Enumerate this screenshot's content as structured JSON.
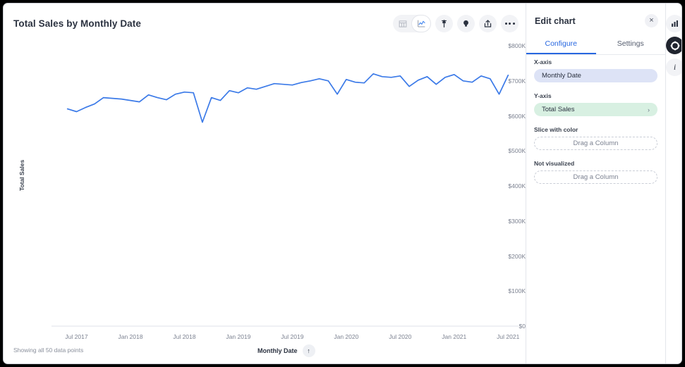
{
  "chart_card": {
    "title": "Total Sales by Monthly Date",
    "footer_note": "Showing all 50 data points",
    "sort_label": "Monthly Date",
    "sort_arrow": "↑",
    "toolbar": [
      {
        "name": "table-view-icon",
        "label": "Table view"
      },
      {
        "name": "line-chart-view-icon",
        "label": "Line chart view"
      },
      {
        "name": "pin-icon",
        "label": "Pin"
      },
      {
        "name": "insights-bulb-icon",
        "label": "Insights"
      },
      {
        "name": "share-icon",
        "label": "Share"
      },
      {
        "name": "more-options-icon",
        "label": "More options"
      }
    ]
  },
  "chart_data": {
    "type": "line",
    "title": "Total Sales by Monthly Date",
    "xlabel": "Monthly Date",
    "ylabel": "Total Sales",
    "grid": false,
    "legend": false,
    "line_color": "#3b7ae8",
    "ylim": [
      0,
      800000
    ],
    "ytick_labels": [
      "$800K",
      "$700K",
      "$600K",
      "$500K",
      "$400K",
      "$300K",
      "$200K",
      "$100K",
      "$0"
    ],
    "ytick_values": [
      800000,
      700000,
      600000,
      500000,
      400000,
      300000,
      200000,
      100000,
      0
    ],
    "xtick_labels": [
      "Jul 2017",
      "Jan 2018",
      "Jul 2018",
      "Jan 2019",
      "Jul 2019",
      "Jan 2020",
      "Jul 2020",
      "Jan 2021",
      "Jul 2021"
    ],
    "xtick_indices": [
      2,
      8,
      14,
      20,
      26,
      32,
      38,
      44,
      50
    ],
    "point_count": 50,
    "x": [
      "May 2017",
      "Jun 2017",
      "Jul 2017",
      "Aug 2017",
      "Sep 2017",
      "Oct 2017",
      "Nov 2017",
      "Dec 2017",
      "Jan 2018",
      "Feb 2018",
      "Mar 2018",
      "Apr 2018",
      "May 2018",
      "Jun 2018",
      "Jul 2018",
      "Aug 2018",
      "Sep 2018",
      "Oct 2018",
      "Nov 2018",
      "Dec 2018",
      "Jan 2019",
      "Feb 2019",
      "Mar 2019",
      "Apr 2019",
      "May 2019",
      "Jun 2019",
      "Jul 2019",
      "Aug 2019",
      "Sep 2019",
      "Oct 2019",
      "Nov 2019",
      "Dec 2019",
      "Jan 2020",
      "Feb 2020",
      "Mar 2020",
      "Apr 2020",
      "May 2020",
      "Jun 2020",
      "Jul 2020",
      "Aug 2020",
      "Sep 2020",
      "Oct 2020",
      "Nov 2020",
      "Dec 2020",
      "Jan 2021",
      "Feb 2021",
      "Mar 2021",
      "Apr 2021",
      "May 2021",
      "Jun 2021"
    ],
    "values": [
      620000,
      612000,
      624000,
      634000,
      652000,
      650000,
      648000,
      644000,
      640000,
      660000,
      652000,
      646000,
      662000,
      668000,
      666000,
      582000,
      652000,
      644000,
      672000,
      666000,
      680000,
      676000,
      684000,
      692000,
      690000,
      688000,
      695000,
      700000,
      706000,
      700000,
      662000,
      704000,
      696000,
      694000,
      720000,
      712000,
      710000,
      714000,
      684000,
      702000,
      712000,
      690000,
      710000,
      718000,
      700000,
      696000,
      714000,
      706000,
      662000,
      716000
    ]
  },
  "edit_panel": {
    "title": "Edit chart",
    "close_icon": "×",
    "tabs": [
      {
        "label": "Configure",
        "active": true
      },
      {
        "label": "Settings",
        "active": false
      }
    ],
    "fields": [
      {
        "label": "X-axis",
        "value": "Monthly Date",
        "style": "blue",
        "chevron": ""
      },
      {
        "label": "Y-axis",
        "value": "Total Sales",
        "style": "green",
        "chevron": "›"
      }
    ],
    "dropzones": [
      {
        "label": "Slice with color",
        "placeholder": "Drag a Column"
      },
      {
        "label": "Not visualized",
        "placeholder": "Drag a Column"
      }
    ]
  },
  "rail": {
    "items": [
      {
        "name": "bar-chart-icon",
        "active": false
      },
      {
        "name": "gear-icon",
        "active": true
      },
      {
        "name": "info-icon",
        "active": false
      }
    ]
  },
  "colors": {
    "accent": "#2767e0",
    "line": "#3b7ae8",
    "pill_blue": "#dde3f6",
    "pill_green": "#d8f0e2",
    "text_dark": "#2b3240",
    "text_muted": "#7b8190"
  }
}
